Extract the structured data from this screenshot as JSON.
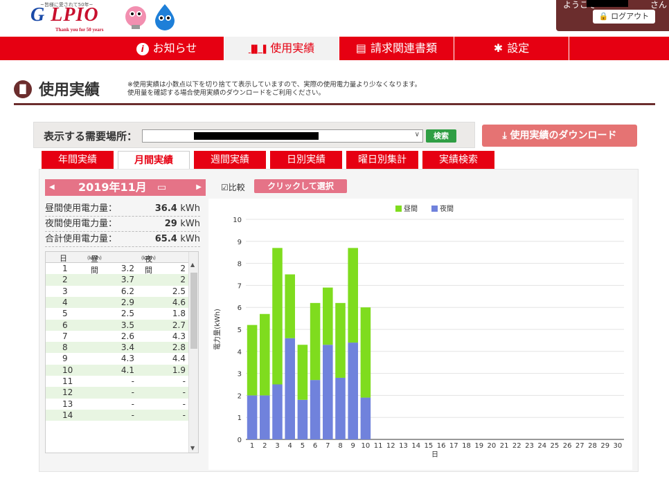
{
  "header": {
    "logo_tagline": "~皆様に愛されて50年~",
    "logo_brand": "LPIO",
    "logo_sub": "Thank you for 50 years",
    "welcome": "ようこそ",
    "san": "さん",
    "logout": "ログアウト"
  },
  "nav": [
    {
      "label": "お知らせ",
      "icon": "info-icon",
      "glyph": "i"
    },
    {
      "label": "使用実績",
      "icon": "chart-icon",
      "glyph": "▐▌▐"
    },
    {
      "label": "請求関連書類",
      "icon": "document-icon",
      "glyph": "▤"
    },
    {
      "label": "設定",
      "icon": "gear-icon",
      "glyph": "✱"
    }
  ],
  "page": {
    "title": "使用実績",
    "note1": "※使用実績は小数点以下を切り捨てて表示していますので、実際の使用電力量より少なくなります。",
    "note2": "使用量を確認する場合使用実績のダウンロードをご利用ください。"
  },
  "filter": {
    "label": "表示する需要場所：",
    "search": "検索",
    "download": "使用実績のダウンロード"
  },
  "tabs": [
    "年間実績",
    "月間実績",
    "週間実績",
    "日別実績",
    "曜日別集計",
    "実績検索"
  ],
  "month": {
    "label": "2019年11月"
  },
  "summary": {
    "day_label": "昼間使用電力量：",
    "day_value": "36.4",
    "unit": "kWh",
    "night_label": "夜間使用電力量：",
    "night_value": "29",
    "total_label": "合計使用電力量：",
    "total_value": "65.4"
  },
  "table": {
    "h_day": "日",
    "h_daytime": "昼間",
    "h_night": "夜間",
    "h_unit": "(kWh)",
    "rows": [
      [
        "1",
        "3.2",
        "2"
      ],
      [
        "2",
        "3.7",
        "2"
      ],
      [
        "3",
        "6.2",
        "2.5"
      ],
      [
        "4",
        "2.9",
        "4.6"
      ],
      [
        "5",
        "2.5",
        "1.8"
      ],
      [
        "6",
        "3.5",
        "2.7"
      ],
      [
        "7",
        "2.6",
        "4.3"
      ],
      [
        "8",
        "3.4",
        "2.8"
      ],
      [
        "9",
        "4.3",
        "4.4"
      ],
      [
        "10",
        "4.1",
        "1.9"
      ],
      [
        "11",
        "-",
        "-"
      ],
      [
        "12",
        "-",
        "-"
      ],
      [
        "13",
        "-",
        "-"
      ],
      [
        "14",
        "-",
        "-"
      ]
    ]
  },
  "compare": {
    "label": "☑比較",
    "button": "クリックして選択"
  },
  "chart_data": {
    "type": "bar",
    "stacked": true,
    "categories": [
      "1",
      "2",
      "3",
      "4",
      "5",
      "6",
      "7",
      "8",
      "9",
      "10",
      "11",
      "12",
      "13",
      "14",
      "15",
      "16",
      "17",
      "18",
      "19",
      "20",
      "21",
      "22",
      "23",
      "24",
      "25",
      "26",
      "27",
      "28",
      "29",
      "30"
    ],
    "series": [
      {
        "name": "夜間",
        "color": "#7082dc",
        "values": [
          2,
          2,
          2.5,
          4.6,
          1.8,
          2.7,
          4.3,
          2.8,
          4.4,
          1.9,
          0,
          0,
          0,
          0,
          0,
          0,
          0,
          0,
          0,
          0,
          0,
          0,
          0,
          0,
          0,
          0,
          0,
          0,
          0,
          0
        ]
      },
      {
        "name": "昼間",
        "color": "#7fdc1e",
        "values": [
          3.2,
          3.7,
          6.2,
          2.9,
          2.5,
          3.5,
          2.6,
          3.4,
          4.3,
          4.1,
          0,
          0,
          0,
          0,
          0,
          0,
          0,
          0,
          0,
          0,
          0,
          0,
          0,
          0,
          0,
          0,
          0,
          0,
          0,
          0
        ]
      }
    ],
    "legend": [
      "昼間",
      "夜間"
    ],
    "xlabel": "日",
    "ylabel": "電力量(kWh)",
    "ylim": [
      0,
      10
    ],
    "yticks": [
      0,
      1,
      2,
      3,
      4,
      5,
      6,
      7,
      8,
      9,
      10
    ],
    "grid": true,
    "legend_position": "top-right"
  }
}
